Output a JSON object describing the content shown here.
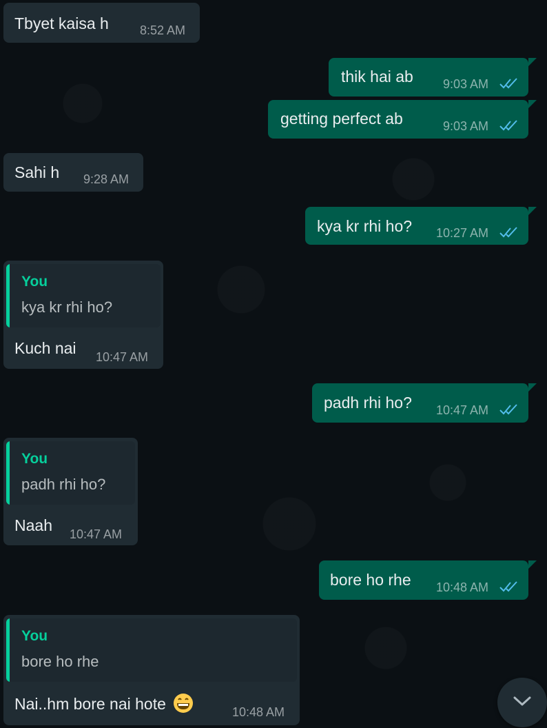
{
  "messages": [
    {
      "direction": "in",
      "text": "Tbyet kaisa h",
      "time": "8:52 AM"
    },
    {
      "direction": "out",
      "text": "thik hai ab",
      "time": "9:03 AM",
      "status": "read"
    },
    {
      "direction": "out",
      "text": "getting perfect ab",
      "time": "9:03 AM",
      "status": "read"
    },
    {
      "direction": "in",
      "text": "Sahi h",
      "time": "9:28 AM"
    },
    {
      "direction": "out",
      "text": "kya kr rhi ho?",
      "time": "10:27 AM",
      "status": "read"
    },
    {
      "direction": "in",
      "text": "Kuch nai",
      "time": "10:47 AM",
      "reply_to": {
        "author": "You",
        "text": "kya kr rhi ho?"
      }
    },
    {
      "direction": "out",
      "text": "padh rhi ho?",
      "time": "10:47 AM",
      "status": "read"
    },
    {
      "direction": "in",
      "text": "Naah",
      "time": "10:47 AM",
      "reply_to": {
        "author": "You",
        "text": "padh rhi ho?"
      }
    },
    {
      "direction": "out",
      "text": "bore ho rhe",
      "time": "10:48 AM",
      "status": "read"
    },
    {
      "direction": "in",
      "text": "Nai..hm bore nai hote",
      "time": "10:48 AM",
      "emoji": "grinning-face-icon",
      "reply_to": {
        "author": "You",
        "text": "bore ho rhe"
      }
    }
  ],
  "icons": {
    "read_receipt": "double-check-icon",
    "scroll_down": "chevron-down-icon"
  },
  "colors": {
    "background": "#0b1014",
    "incoming_bubble": "#202c33",
    "outgoing_bubble": "#005c4b",
    "quote_accent": "#06cf9c",
    "read_tick": "#53bdeb"
  }
}
